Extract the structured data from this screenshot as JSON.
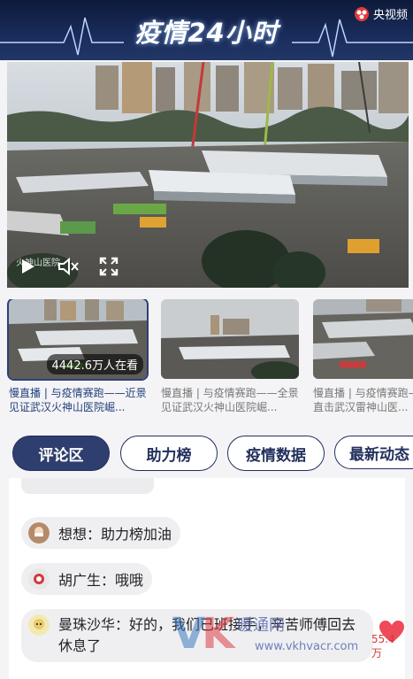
{
  "header": {
    "title": "疫情24小时",
    "brand": "央视频"
  },
  "video": {
    "watermark": "火神山医院"
  },
  "live_cards": [
    {
      "caption": "慢直播 | 与疫情赛跑——近景见证武汉火神山医院崛...",
      "viewers": "4442.6万人在看",
      "active": true
    },
    {
      "caption": "慢直播 | 与疫情赛跑——全景见证武汉火神山医院崛...",
      "active": false
    },
    {
      "caption": "慢直播 | 与疫情赛跑——近景直击武汉雷神山医...",
      "active": false
    }
  ],
  "tabs": [
    {
      "label": "评论区",
      "active": true
    },
    {
      "label": "助力榜",
      "active": false
    },
    {
      "label": "疫情数据",
      "active": false
    },
    {
      "label": "最新动态",
      "active": false
    }
  ],
  "comments": [
    {
      "user": "想想",
      "text": "助力榜加油"
    },
    {
      "user": "胡广生",
      "text": "哦哦"
    },
    {
      "user": "曼珠沙华",
      "text": "好的，我们已班接手，辛苦师傅回去休息了"
    }
  ],
  "like": {
    "count": "55.4万"
  },
  "watermark": {
    "text": "暖通网",
    "url": "www.vkhvacr.com"
  }
}
